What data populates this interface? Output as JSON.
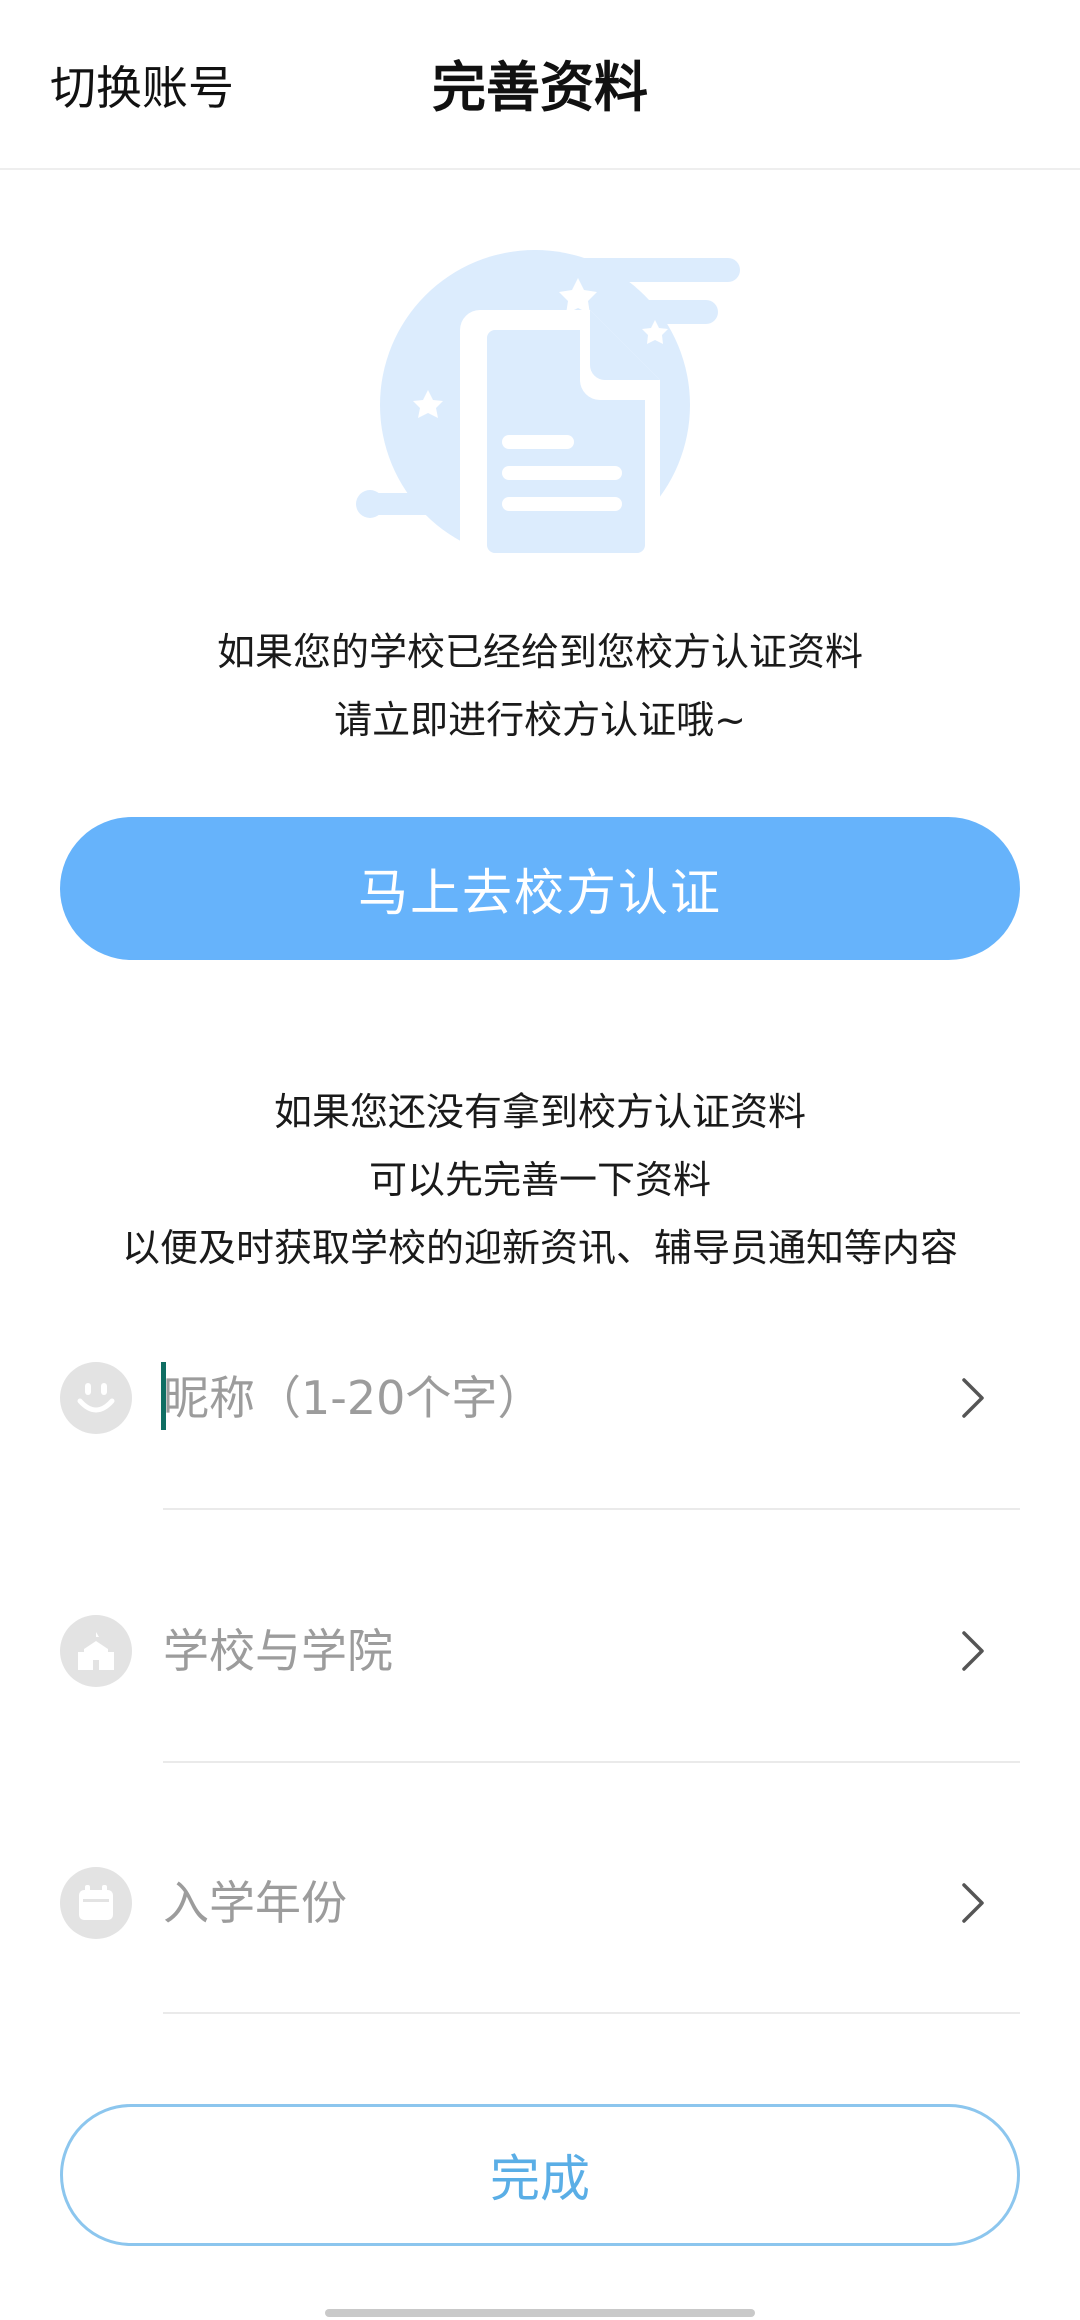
{
  "navbar": {
    "switch_account": "切换账号",
    "title": "完善资料"
  },
  "intro_school": {
    "line1": "如果您的学校已经给到您校方认证资料",
    "line2": "请立即进行校方认证哦~"
  },
  "verify_button": "马上去校方认证",
  "intro_profile": {
    "line1": "如果您还没有拿到校方认证资料",
    "line2": "可以先完善一下资料",
    "line3": "以便及时获取学校的迎新资讯、辅导员通知等内容"
  },
  "form": {
    "nickname": {
      "placeholder": "昵称（1-20个字）",
      "icon": "smiley-icon"
    },
    "school": {
      "placeholder": "学校与学院",
      "icon": "school-icon"
    },
    "year": {
      "placeholder": "入学年份",
      "icon": "calendar-icon"
    }
  },
  "done_button": "完成",
  "colors": {
    "primary": "#66b3fb",
    "outline": "#8cc6ee",
    "placeholder": "#9c9c9c",
    "cursor": "#0f6e63"
  }
}
